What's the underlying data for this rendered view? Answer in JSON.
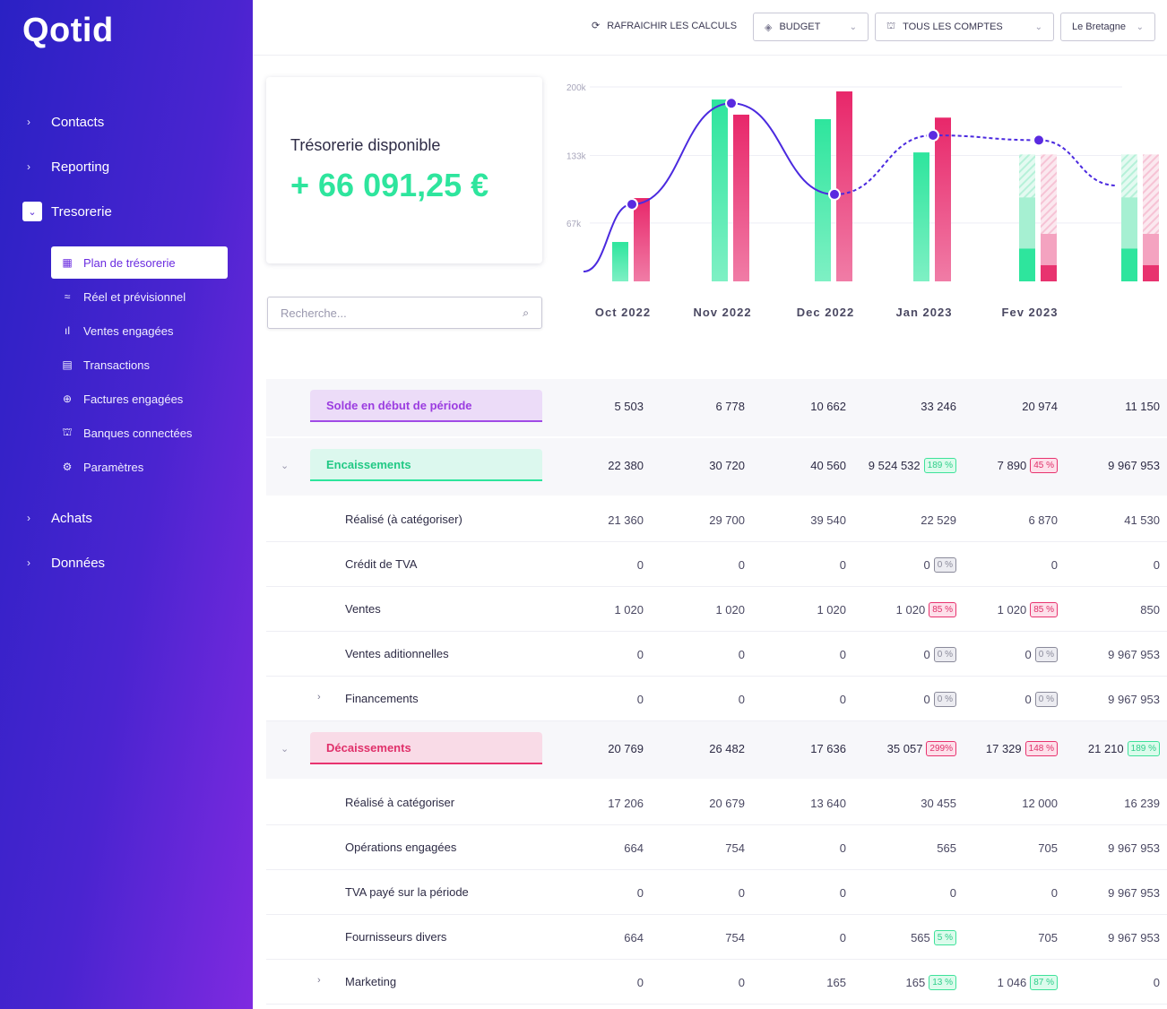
{
  "app": {
    "logo": "Qotid"
  },
  "sidebar": {
    "nav": [
      {
        "label": "Contacts"
      },
      {
        "label": "Reporting"
      },
      {
        "label": "Tresorerie"
      },
      {
        "label": "Achats"
      },
      {
        "label": "Données"
      }
    ],
    "sub": [
      {
        "label": "Plan de trésorerie",
        "icon": "grid-icon",
        "glyph": "▦",
        "active": true
      },
      {
        "label": "Réel et prévisionnel",
        "icon": "trend-icon",
        "glyph": "≈"
      },
      {
        "label": "Ventes engagées",
        "icon": "bar-chart-icon",
        "glyph": "ıl"
      },
      {
        "label": "Transactions",
        "icon": "receipt-icon",
        "glyph": "▤"
      },
      {
        "label": "Factures engagées",
        "icon": "download-circle-icon",
        "glyph": "⊕"
      },
      {
        "label": "Banques connectées",
        "icon": "bank-icon",
        "glyph": "⛫"
      },
      {
        "label": "Paramètres",
        "icon": "gear-icon",
        "glyph": "⚙"
      }
    ]
  },
  "toolbar": {
    "refresh": "RAFRAICHIR LES CALCULS",
    "budget": "BUDGET",
    "accounts": "TOUS LES COMPTES",
    "company": "Le Bretagne"
  },
  "card": {
    "title": "Trésorerie disponible",
    "amount": "+ 66 091,25 €"
  },
  "search": {
    "placeholder": "Recherche..."
  },
  "colors": {
    "green": "#2ee59d",
    "red": "#e8336f",
    "line": "#4b2adf",
    "accent": "#6a2be0"
  },
  "chart_data": {
    "type": "bar",
    "categories": [
      "Oct 2022",
      "Nov 2022",
      "Dec 2022",
      "Jan 2023",
      "Fev 2023",
      ""
    ],
    "y_ticks": [
      "200k",
      "133k",
      "67k"
    ],
    "ylim": [
      10000,
      200000
    ],
    "grid": true,
    "series": [
      {
        "values": [
          48500,
          187700,
          168500,
          136000,
          42000,
          42000
        ],
        "projected": [
          null,
          null,
          null,
          null,
          92000,
          92000
        ],
        "forecast": [
          null,
          null,
          null,
          null,
          134000,
          134000
        ],
        "color": "#2ee59d"
      },
      {
        "values": [
          91400,
          172900,
          195600,
          170000,
          25800,
          25800
        ],
        "projected": [
          null,
          null,
          null,
          null,
          56400,
          56400
        ],
        "forecast": [
          null,
          null,
          null,
          null,
          134000,
          134000
        ],
        "color": "#e8336f"
      }
    ],
    "line": {
      "points": [
        85300,
        184000,
        95000,
        152700,
        148000
      ],
      "start": 19600,
      "end": 103700,
      "dashed_from": "Dec 2022"
    }
  },
  "table": {
    "rows": [
      {
        "label": "Solde en début de période",
        "type": "group",
        "tone": "purple",
        "cells": [
          {
            "v": "5 503"
          },
          {
            "v": "6 778"
          },
          {
            "v": "10 662"
          },
          {
            "v": "33 246"
          },
          {
            "v": "20 974"
          },
          {
            "v": "11 150"
          }
        ]
      },
      {
        "label": "Encaissements",
        "type": "group",
        "tone": "green",
        "expandable": true,
        "cells": [
          {
            "v": "22 380"
          },
          {
            "v": "30 720"
          },
          {
            "v": "40 560"
          },
          {
            "v": "9 524 532",
            "badge": "189 %",
            "tone": "green"
          },
          {
            "v": "7 890",
            "badge": "45 %",
            "tone": "red"
          },
          {
            "v": "9 967 953"
          }
        ]
      },
      {
        "label": "Réalisé (à catégoriser)",
        "cells": [
          {
            "v": "21 360"
          },
          {
            "v": "29 700"
          },
          {
            "v": "39 540"
          },
          {
            "v": "22 529"
          },
          {
            "v": "6 870"
          },
          {
            "v": "41 530"
          }
        ]
      },
      {
        "label": "Crédit de TVA",
        "cells": [
          {
            "v": "0"
          },
          {
            "v": "0"
          },
          {
            "v": "0"
          },
          {
            "v": "0",
            "badge": "0 %",
            "tone": "gray"
          },
          {
            "v": "0"
          },
          {
            "v": "0"
          }
        ]
      },
      {
        "label": "Ventes",
        "cells": [
          {
            "v": "1 020"
          },
          {
            "v": "1 020"
          },
          {
            "v": "1 020"
          },
          {
            "v": "1 020",
            "badge": "85 %",
            "tone": "red"
          },
          {
            "v": "1 020",
            "badge": "85 %",
            "tone": "red"
          },
          {
            "v": "850"
          }
        ]
      },
      {
        "label": "Ventes aditionnelles",
        "cells": [
          {
            "v": "0"
          },
          {
            "v": "0"
          },
          {
            "v": "0"
          },
          {
            "v": "0",
            "badge": "0 %",
            "tone": "gray"
          },
          {
            "v": "0",
            "badge": "0 %",
            "tone": "gray"
          },
          {
            "v": "9 967 953"
          }
        ]
      },
      {
        "label": "Financements",
        "expandable": true,
        "cells": [
          {
            "v": "0"
          },
          {
            "v": "0"
          },
          {
            "v": "0"
          },
          {
            "v": "0",
            "badge": "0 %",
            "tone": "gray"
          },
          {
            "v": "0",
            "badge": "0 %",
            "tone": "gray"
          },
          {
            "v": "9 967 953"
          }
        ]
      },
      {
        "label": "Décaissements",
        "type": "group",
        "tone": "red",
        "expandable": true,
        "cells": [
          {
            "v": "20 769"
          },
          {
            "v": "26 482"
          },
          {
            "v": "17 636"
          },
          {
            "v": "35 057",
            "badge": "299%",
            "tone": "red"
          },
          {
            "v": "17 329",
            "badge": "148 %",
            "tone": "red"
          },
          {
            "v": "21 210",
            "badge": "189 %",
            "tone": "green"
          }
        ]
      },
      {
        "label": "Réalisé à catégoriser",
        "cells": [
          {
            "v": "17 206"
          },
          {
            "v": "20 679"
          },
          {
            "v": "13 640"
          },
          {
            "v": "30 455"
          },
          {
            "v": "12 000"
          },
          {
            "v": "16 239"
          }
        ]
      },
      {
        "label": "Opérations engagées",
        "cells": [
          {
            "v": "664"
          },
          {
            "v": "754"
          },
          {
            "v": "0"
          },
          {
            "v": "565"
          },
          {
            "v": "705"
          },
          {
            "v": "9 967 953"
          }
        ]
      },
      {
        "label": "TVA payé sur la période",
        "cells": [
          {
            "v": "0"
          },
          {
            "v": "0"
          },
          {
            "v": "0"
          },
          {
            "v": "0"
          },
          {
            "v": "0"
          },
          {
            "v": "9 967 953"
          }
        ]
      },
      {
        "label": "Fournisseurs divers",
        "cells": [
          {
            "v": "664"
          },
          {
            "v": "754"
          },
          {
            "v": "0"
          },
          {
            "v": "565",
            "badge": "5 %",
            "tone": "green"
          },
          {
            "v": "705"
          },
          {
            "v": "9 967 953"
          }
        ]
      },
      {
        "label": "Marketing",
        "expandable": true,
        "cells": [
          {
            "v": "0"
          },
          {
            "v": "0"
          },
          {
            "v": "165"
          },
          {
            "v": "165",
            "badge": "13 %",
            "tone": "green"
          },
          {
            "v": "1 046",
            "badge": "87 %",
            "tone": "green"
          },
          {
            "v": "0"
          }
        ]
      }
    ]
  }
}
